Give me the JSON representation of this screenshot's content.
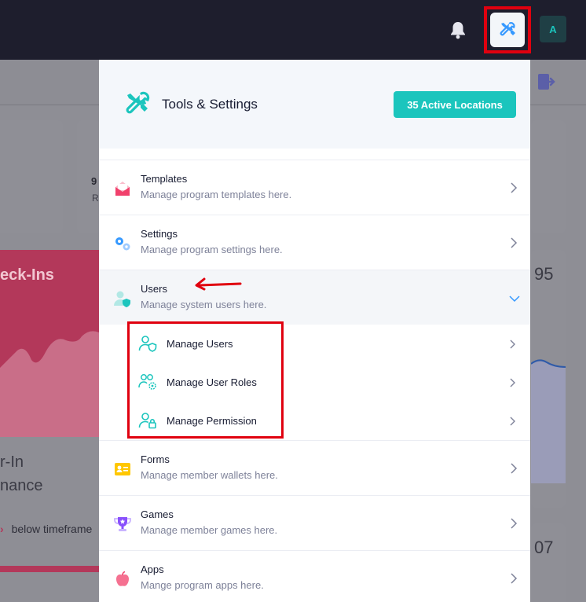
{
  "topbar": {
    "avatar_initial": "A",
    "icons": [
      "bell-icon",
      "tools-icon"
    ],
    "accent_color": "#1bc5bd"
  },
  "background": {
    "card_number": "9",
    "card_sub": "R",
    "chart_title": "eck-Ins",
    "perf_line1": "r-In",
    "perf_line2": "nance",
    "below_timeframe": "below timeframe",
    "num_top": "95",
    "num_bottom": "07"
  },
  "panel": {
    "title": "Tools & Settings",
    "badge": "35 Active Locations",
    "items": [
      {
        "title": "Templates",
        "desc": "Manage program templates here.",
        "icon": "envelope-icon"
      },
      {
        "title": "Settings",
        "desc": "Manage program settings here.",
        "icon": "gears-icon"
      },
      {
        "title": "Users",
        "desc": "Manage system users here.",
        "icon": "user-shield-icon"
      },
      {
        "title": "Forms",
        "desc": "Manage member wallets here.",
        "icon": "id-card-icon"
      },
      {
        "title": "Games",
        "desc": "Manage member games here.",
        "icon": "trophy-icon"
      },
      {
        "title": "Apps",
        "desc": "Mange program apps here.",
        "icon": "apple-icon"
      }
    ],
    "users_sub": [
      {
        "label": "Manage Users",
        "icon": "user-shield-outline-icon"
      },
      {
        "label": "Manage User Roles",
        "icon": "user-group-gear-icon"
      },
      {
        "label": "Manage Permission",
        "icon": "user-lock-icon"
      }
    ]
  },
  "annotations": {
    "highlight_color": "#e0000f"
  }
}
